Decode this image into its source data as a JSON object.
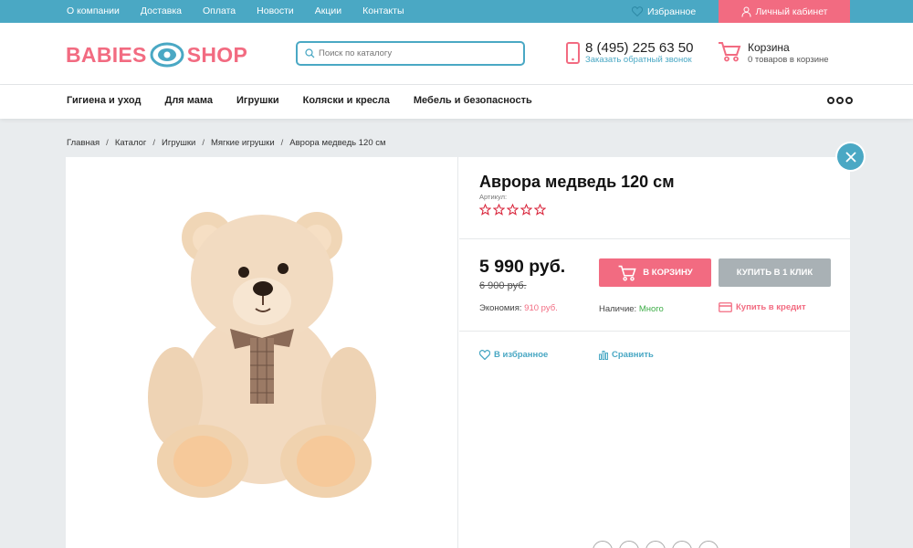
{
  "topbar": {
    "nav": [
      "О компании",
      "Доставка",
      "Оплата",
      "Новости",
      "Акции",
      "Контакты"
    ],
    "favorites": "Избранное",
    "cabinet": "Личный кабинет"
  },
  "header": {
    "logo_left": "BABIES",
    "logo_right": "SHOP",
    "search_placeholder": "Поиск по каталогу",
    "phone": "8 (495) 225 63 50",
    "callback": "Заказать обратный звонок",
    "cart_title": "Корзина",
    "cart_sub": "0 товаров в корзине"
  },
  "catnav": {
    "items": [
      "Гигиена и уход",
      "Для мама",
      "Игрушки",
      "Коляски и кресла",
      "Мебель и безопасность"
    ]
  },
  "breadcrumb": [
    "Главная",
    "Каталог",
    "Игрушки",
    "Мягкие игрушки",
    "Аврора медведь 120 см"
  ],
  "product": {
    "title": "Аврора медведь 120 см",
    "sku_label": "Артикул:",
    "rating": 0,
    "rating_max": 5,
    "price": "5 990 руб.",
    "old_price": "6 900 руб.",
    "economy_label": "Экономия:",
    "economy_value": "910 руб.",
    "add_to_cart": "В КОРЗИНУ",
    "one_click": "КУПИТЬ В 1 КЛИК",
    "availability_label": "Наличие:",
    "availability_value": "Много",
    "credit": "Купить в кредит",
    "favorite": "В избранное",
    "compare": "Сравнить"
  },
  "colors": {
    "accent": "#4aa8c4",
    "brand_pink": "#f26b81",
    "in_stock": "#3fae49",
    "disabled_button": "#a9b1b5"
  },
  "icons": [
    "heart-icon",
    "user-icon",
    "pacifier-logo-icon",
    "search-icon",
    "phone-icon",
    "cart-icon",
    "more-icon",
    "star-icon",
    "credit-card-icon",
    "compare-icon",
    "close-icon"
  ]
}
